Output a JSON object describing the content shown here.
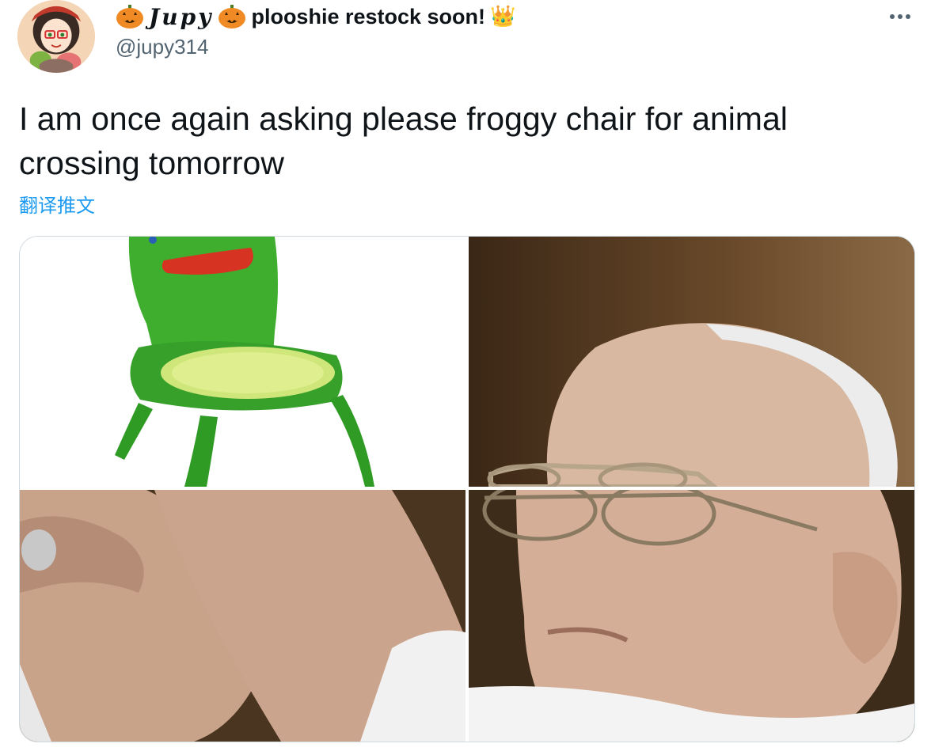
{
  "author": {
    "display_name": "Jupy",
    "name_suffix": "plooshie restock soon!",
    "handle": "@jupy314",
    "crown_emoji": "👑",
    "name_icons": [
      "jack-o-lantern-icon",
      "crown-icon"
    ]
  },
  "tweet": {
    "text": "I am once again asking please froggy chair for animal crossing tomorrow",
    "translate_label": "翻译推文"
  },
  "media": {
    "layout": "2x2 grid",
    "tiles": [
      "froggy-chair",
      "man-face-upper",
      "hands-pinched",
      "man-face-lower"
    ]
  },
  "colors": {
    "text": "#0f1419",
    "secondary": "#536471",
    "link": "#1d9bf0",
    "border": "#cfd9de"
  }
}
